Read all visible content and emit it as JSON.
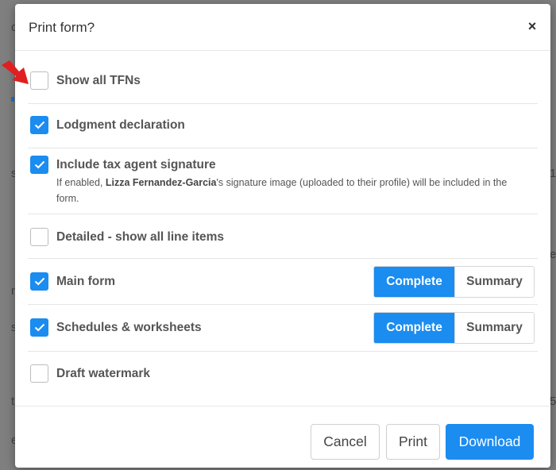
{
  "dialog": {
    "title": "Print form?",
    "close_icon": "close-icon",
    "close_symbol": "×"
  },
  "options": [
    {
      "label": "Show all TFNs",
      "checked": false
    },
    {
      "label": "Lodgment declaration",
      "checked": true
    },
    {
      "label": "Include tax agent signature",
      "checked": true,
      "description_prefix": "If enabled, ",
      "description_name": "Lizza Fernandez-Garcia",
      "description_suffix": "'s signature image (uploaded to their profile) will be included in the form."
    },
    {
      "label": "Detailed - show all line items",
      "checked": false
    },
    {
      "label": "Main form",
      "checked": true,
      "modes": [
        "Complete",
        "Summary"
      ],
      "selected_mode": "Complete"
    },
    {
      "label": "Schedules & worksheets",
      "checked": true,
      "modes": [
        "Complete",
        "Summary"
      ],
      "selected_mode": "Complete"
    },
    {
      "label": "Draft watermark",
      "checked": false
    }
  ],
  "footer": {
    "cancel_label": "Cancel",
    "print_label": "Print",
    "download_label": "Download"
  },
  "colors": {
    "primary": "#1b8cf0",
    "annotation_arrow": "#e02020"
  },
  "background_fragments": [
    "c",
    "s",
    "1",
    "e",
    "n",
    "s",
    "5",
    "t",
    "e"
  ]
}
